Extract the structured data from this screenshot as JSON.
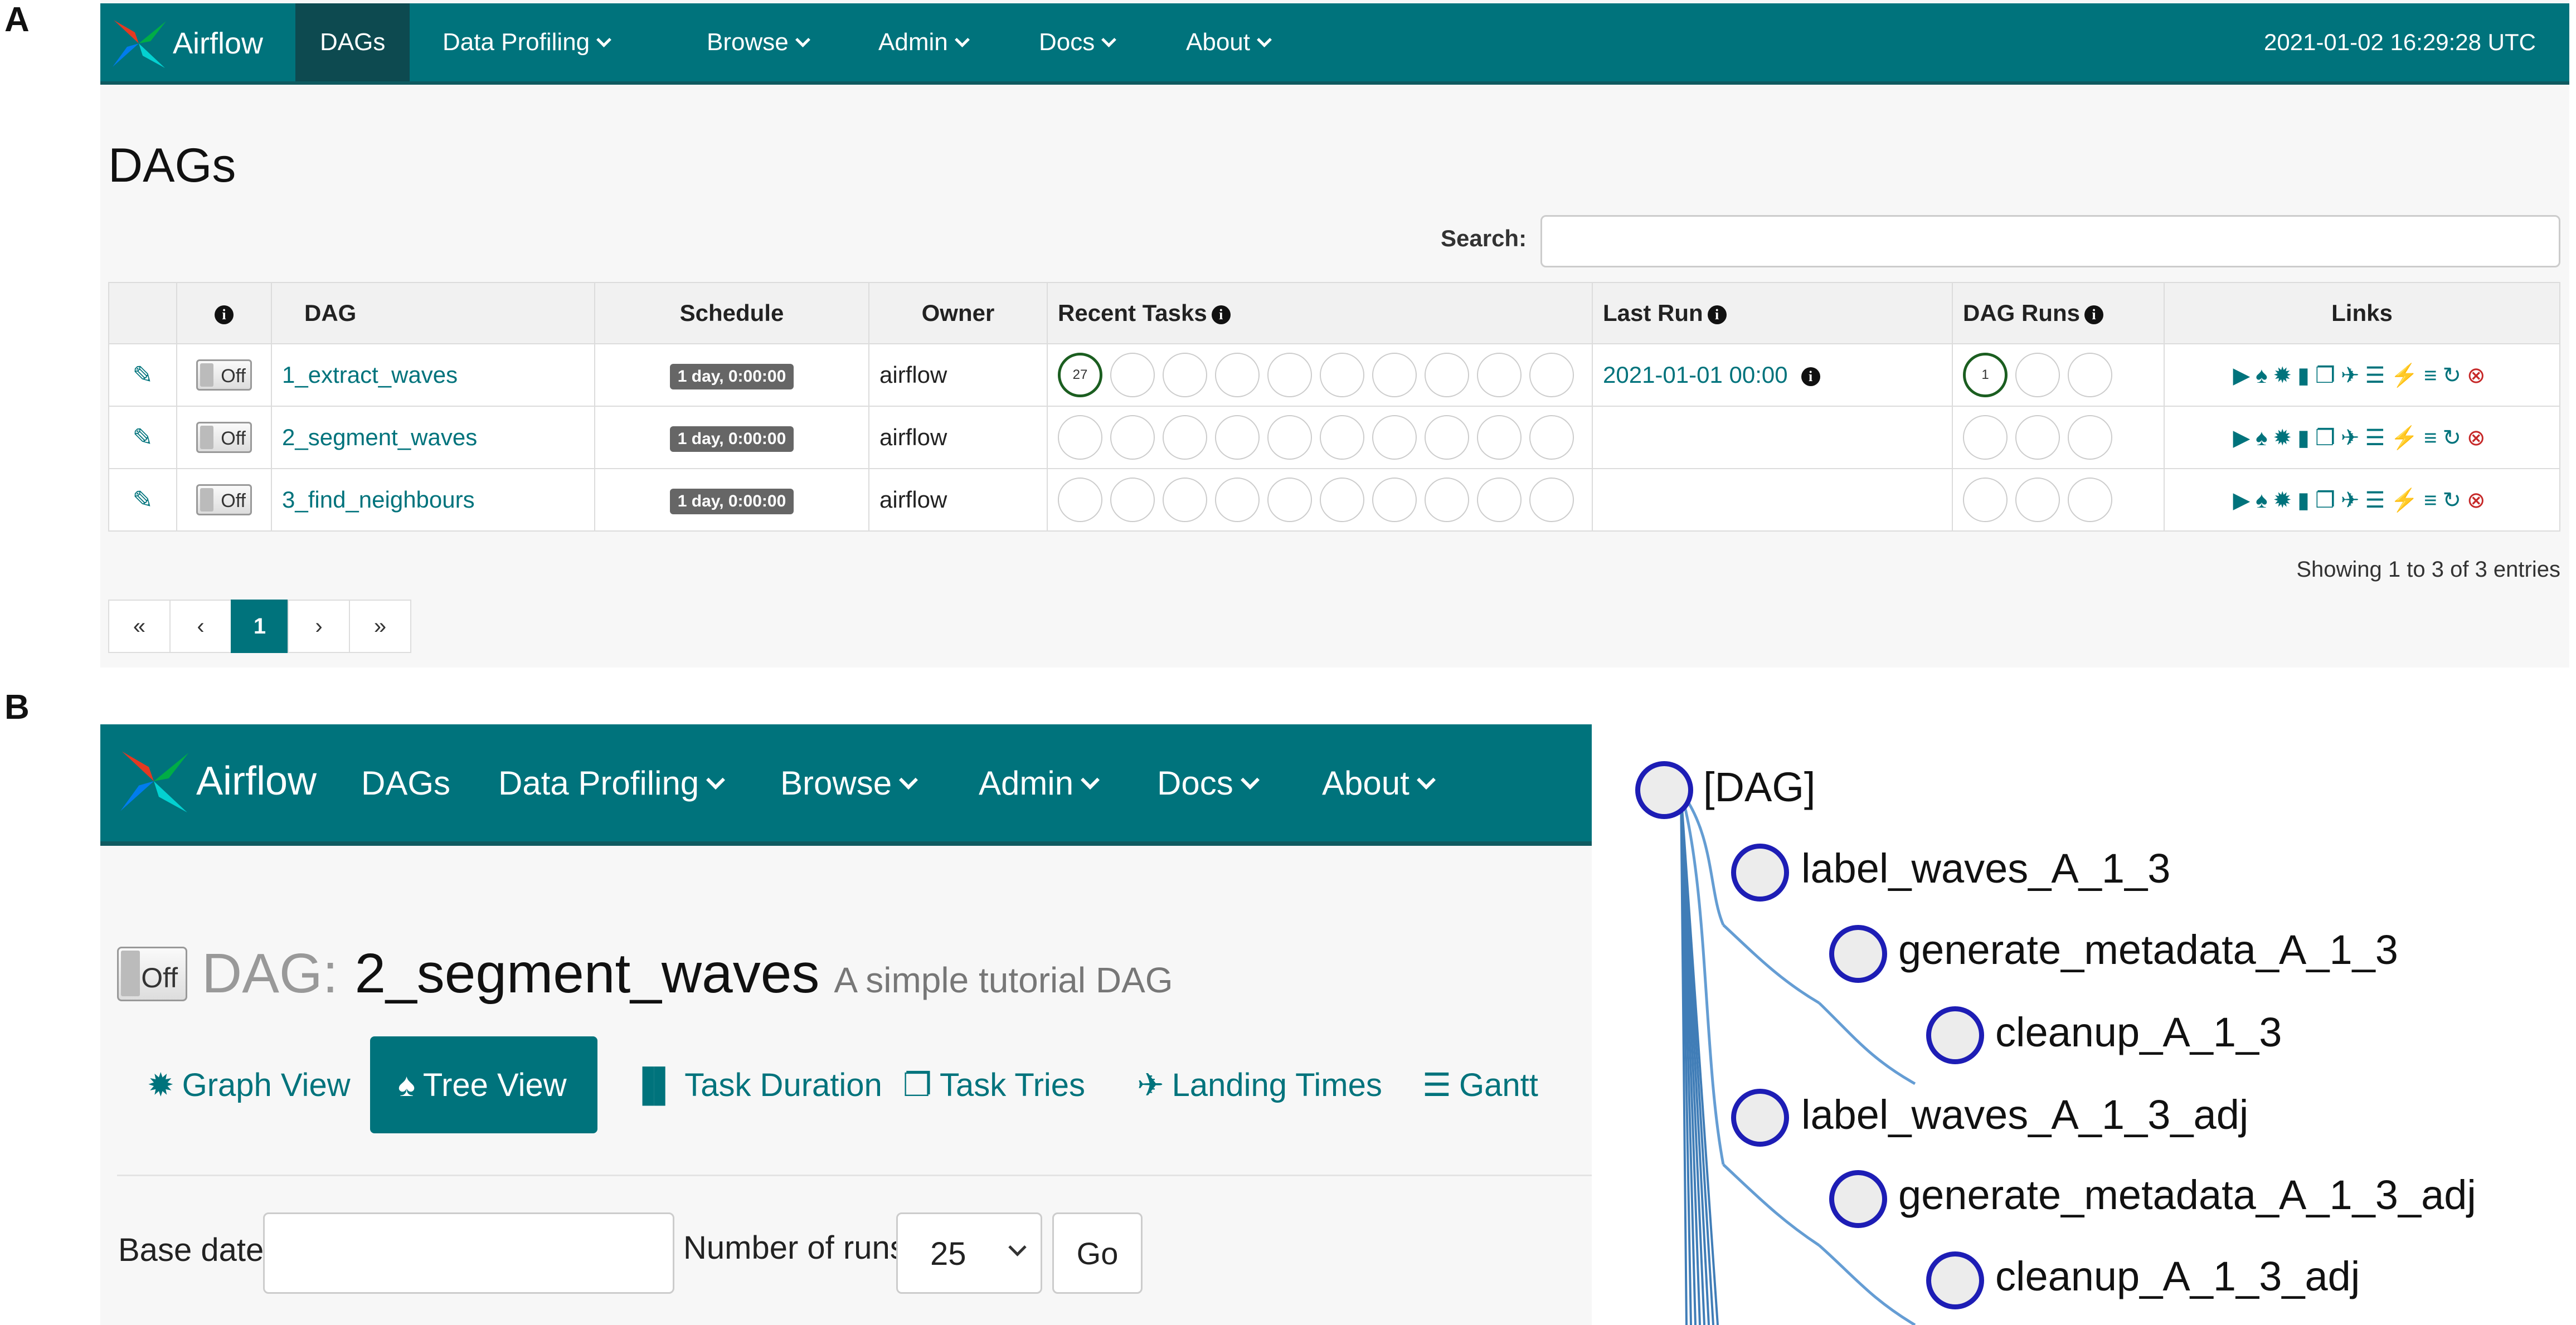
{
  "panels": {
    "a_label": "A",
    "b_label": "B"
  },
  "colors": {
    "nav_bg": "#00737c",
    "nav_active": "#0d4a50",
    "link": "#00737c",
    "success_ring": "#1b5e20",
    "tree_node_ring": "#1d1db5",
    "tree_edge": "#4a8ccc"
  },
  "panel_a": {
    "navbar": {
      "brand": "Airflow",
      "items": [
        {
          "label": "DAGs",
          "dropdown": false,
          "active": true
        },
        {
          "label": "Data Profiling",
          "dropdown": true
        },
        {
          "label": "Browse",
          "dropdown": true
        },
        {
          "label": "Admin",
          "dropdown": true
        },
        {
          "label": "Docs",
          "dropdown": true
        },
        {
          "label": "About",
          "dropdown": true
        }
      ],
      "timestamp": "2021-01-02 16:29:28 UTC"
    },
    "page_title": "DAGs",
    "search": {
      "label": "Search:",
      "value": ""
    },
    "table": {
      "headers": {
        "info": "i",
        "dag": "DAG",
        "schedule": "Schedule",
        "owner": "Owner",
        "recent_tasks": "Recent Tasks",
        "last_run": "Last Run",
        "dag_runs": "DAG Runs",
        "links": "Links"
      },
      "rows": [
        {
          "toggle": "Off",
          "dag": "1_extract_waves",
          "schedule": "1 day, 0:00:00",
          "owner": "airflow",
          "recent_task_success": "27",
          "last_run": "2021-01-01 00:00",
          "dag_run_success": "1"
        },
        {
          "toggle": "Off",
          "dag": "2_segment_waves",
          "schedule": "1 day, 0:00:00",
          "owner": "airflow",
          "recent_task_success": "",
          "last_run": "",
          "dag_run_success": ""
        },
        {
          "toggle": "Off",
          "dag": "3_find_neighbours",
          "schedule": "1 day, 0:00:00",
          "owner": "airflow",
          "recent_task_success": "",
          "last_run": "",
          "dag_run_success": ""
        }
      ],
      "link_icons": [
        "trigger-dag-icon",
        "tree-view-icon",
        "graph-view-icon",
        "task-duration-icon",
        "task-tries-icon",
        "landing-times-icon",
        "gantt-icon",
        "code-view-icon",
        "logs-icon",
        "refresh-icon",
        "delete-dag-icon"
      ]
    },
    "showing": "Showing 1 to 3 of 3 entries",
    "pager": {
      "first": "«",
      "prev": "‹",
      "current": "1",
      "next": "›",
      "last": "»"
    }
  },
  "panel_b": {
    "navbar": {
      "brand": "Airflow",
      "items": [
        {
          "label": "DAGs",
          "dropdown": false
        },
        {
          "label": "Data Profiling",
          "dropdown": true
        },
        {
          "label": "Browse",
          "dropdown": true
        },
        {
          "label": "Admin",
          "dropdown": true
        },
        {
          "label": "Docs",
          "dropdown": true
        },
        {
          "label": "About",
          "dropdown": true
        }
      ]
    },
    "dag_header": {
      "toggle": "Off",
      "label": "DAG:",
      "name": "2_segment_waves",
      "description": "A simple tutorial DAG"
    },
    "tabs": [
      {
        "label": "Graph View",
        "icon": "graph-view-icon"
      },
      {
        "label": "Tree View",
        "icon": "tree-view-icon",
        "active": true
      },
      {
        "label": "Task Duration",
        "icon": "task-duration-icon"
      },
      {
        "label": "Task Tries",
        "icon": "task-tries-icon"
      },
      {
        "label": "Landing Times",
        "icon": "landing-times-icon"
      },
      {
        "label": "Gantt",
        "icon": "gantt-icon"
      }
    ],
    "form": {
      "base_date_label": "Base date:",
      "base_date_value": "",
      "num_runs_label": "Number of runs:",
      "num_runs_value": "25",
      "go_label": "Go"
    },
    "tree": {
      "nodes": [
        {
          "label": "[DAG]",
          "depth": 0
        },
        {
          "label": "label_waves_A_1_3",
          "depth": 1
        },
        {
          "label": "generate_metadata_A_1_3",
          "depth": 2
        },
        {
          "label": "cleanup_A_1_3",
          "depth": 3
        },
        {
          "label": "label_waves_A_1_3_adj",
          "depth": 1
        },
        {
          "label": "generate_metadata_A_1_3_adj",
          "depth": 2
        },
        {
          "label": "cleanup_A_1_3_adj",
          "depth": 3
        }
      ]
    }
  }
}
